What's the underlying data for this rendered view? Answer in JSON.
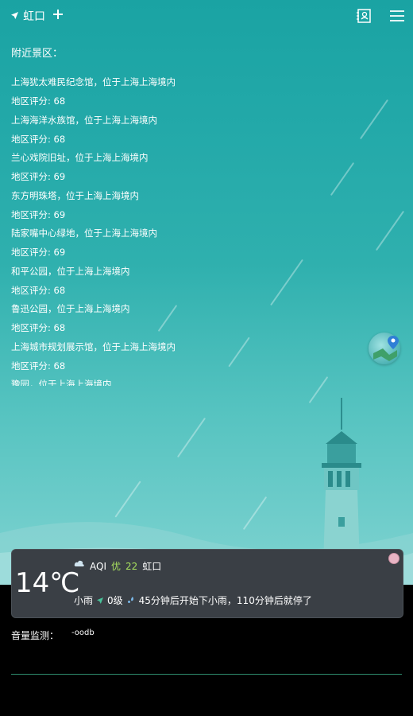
{
  "header": {
    "location": "虹口",
    "location_icon": "navigation-arrow-icon",
    "add_icon": "plus-icon",
    "contacts_icon": "contact-book-icon",
    "menu_icon": "hamburger-menu-icon"
  },
  "nearby": {
    "title": "附近景区：",
    "items": [
      {
        "name": "上海犹太难民纪念馆，位于上海上海境内",
        "score": "地区评分: 68"
      },
      {
        "name": "上海海洋水族馆，位于上海上海境内",
        "score": "地区评分: 68"
      },
      {
        "name": "兰心戏院旧址，位于上海上海境内",
        "score": "地区评分: 69"
      },
      {
        "name": "东方明珠塔，位于上海上海境内",
        "score": "地区评分: 69"
      },
      {
        "name": "陆家嘴中心绿地，位于上海上海境内",
        "score": "地区评分: 69"
      },
      {
        "name": "和平公园，位于上海上海境内",
        "score": "地区评分: 68"
      },
      {
        "name": "鲁迅公园，位于上海上海境内",
        "score": "地区评分: 68"
      },
      {
        "name": "上海城市规划展示馆，位于上海上海境内",
        "score": "地区评分: 68"
      },
      {
        "name": "豫园，位于上海上海境内",
        "score": ""
      }
    ]
  },
  "weather": {
    "temperature": "14℃",
    "aqi_label": "AQI",
    "aqi_level": "优",
    "aqi_value": "22",
    "district": "虹口",
    "condition": "小雨",
    "wind": "0级",
    "forecast": "45分钟后开始下小雨，110分钟后就停了"
  },
  "volume": {
    "label": "音量监测：",
    "value": "-oodb"
  },
  "colors": {
    "sky_top": "#1aa3a3",
    "card_bg": "#3a3f45",
    "aqi_good": "#a8e05f",
    "divider": "#2e8d6e"
  }
}
